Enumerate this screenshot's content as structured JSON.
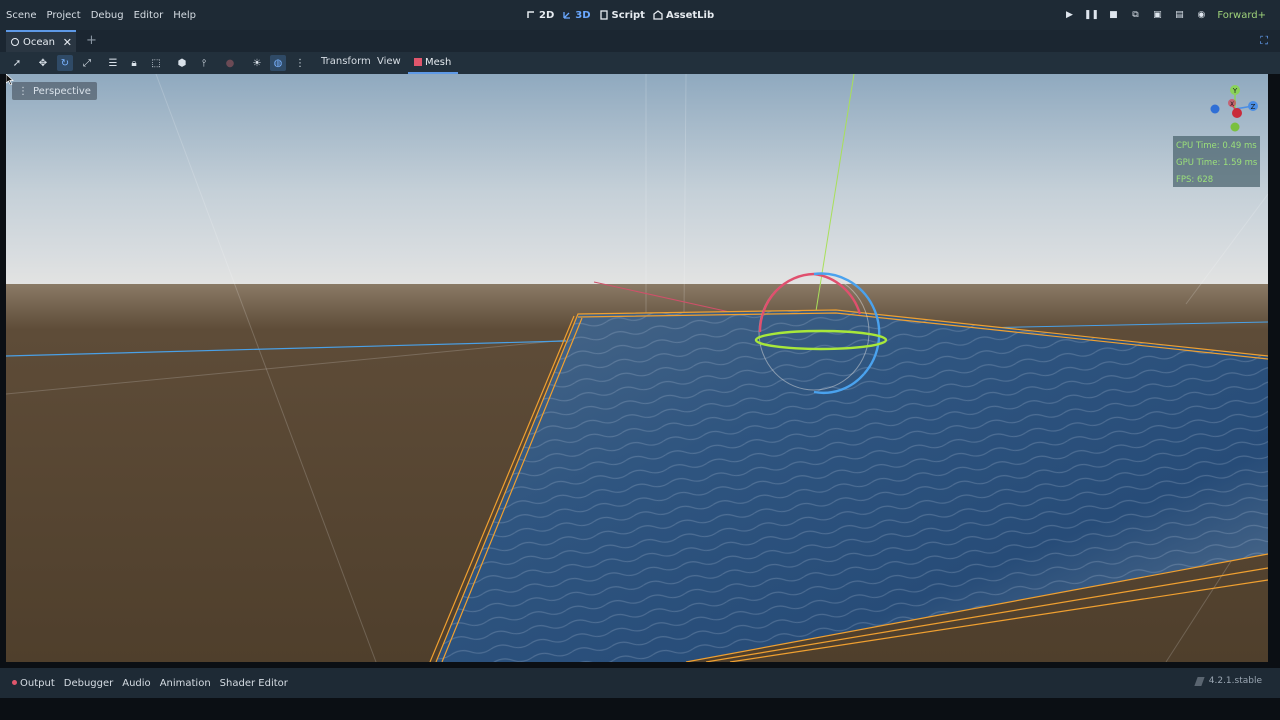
{
  "menu": [
    "Scene",
    "Project",
    "Debug",
    "Editor",
    "Help"
  ],
  "workspaces": [
    {
      "label": "2D",
      "icon": "2d-icon",
      "active": false
    },
    {
      "label": "3D",
      "icon": "3d-icon",
      "active": true
    },
    {
      "label": "Script",
      "icon": "script-icon",
      "active": false
    },
    {
      "label": "AssetLib",
      "icon": "assetlib-icon",
      "active": false
    }
  ],
  "renderer": "Forward+",
  "scene_tab": {
    "label": "Ocean"
  },
  "toolbar": {
    "transform_label": "Transform",
    "view_label": "View",
    "mesh_label": "Mesh"
  },
  "viewport": {
    "perspective_label": "Perspective",
    "stats": {
      "cpu": "CPU Time: 0.49 ms",
      "gpu": "GPU Time: 1.59 ms",
      "fps": "FPS: 628"
    },
    "gizmo": {
      "x": "X",
      "y": "Y",
      "z": "Z"
    }
  },
  "bottom_tabs": [
    "Output",
    "Debugger",
    "Audio",
    "Animation",
    "Shader Editor"
  ],
  "version": "4.2.1.stable",
  "colors": {
    "accent": "#5e99e6",
    "stats_text": "#9be07a",
    "selection": "#f0a030"
  }
}
